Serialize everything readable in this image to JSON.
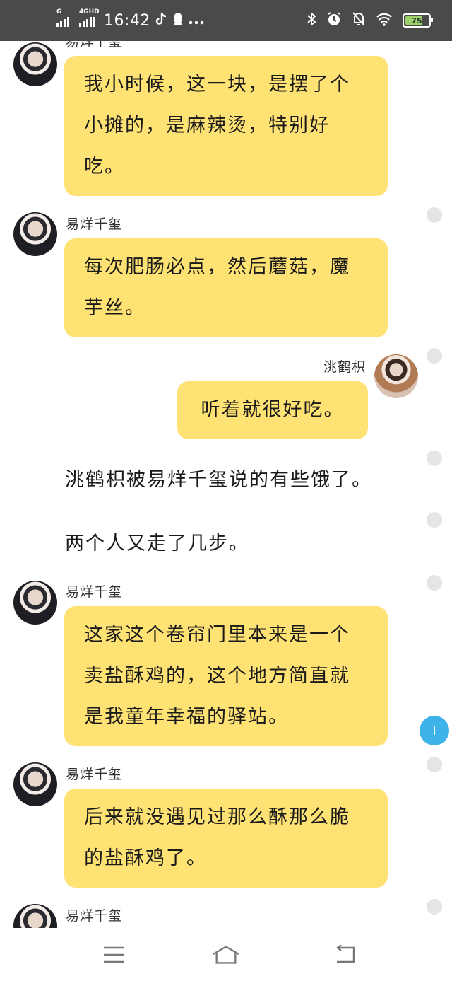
{
  "status_bar": {
    "signal1_label": "G",
    "signal2_label": "4GHD",
    "time": "16:42",
    "battery": "75",
    "battery_level": 0.75
  },
  "messages": [
    {
      "name": "易烊千玺",
      "text": "我小时候，这一块，是摆了个小摊的，是麻辣烫，特别好吃。"
    },
    {
      "name": "易烊千玺",
      "text": "每次肥肠必点，然后蘑菇，魔芋丝。"
    },
    {
      "name": "洮鹤枳",
      "text": "听着就很好吃。"
    },
    {
      "narration": "洮鹤枳被易烊千玺说的有些饿了。"
    },
    {
      "narration": "两个人又走了几步。"
    },
    {
      "name": "易烊千玺",
      "text": "这家这个卷帘门里本来是一个卖盐酥鸡的，这个地方简直就是我童年幸福的驿站。"
    },
    {
      "name": "易烊千玺",
      "text": "后来就没遇见过那么酥那么脆的盐酥鸡了。"
    },
    {
      "name": "易烊千玺"
    }
  ],
  "scroll_button": "I"
}
